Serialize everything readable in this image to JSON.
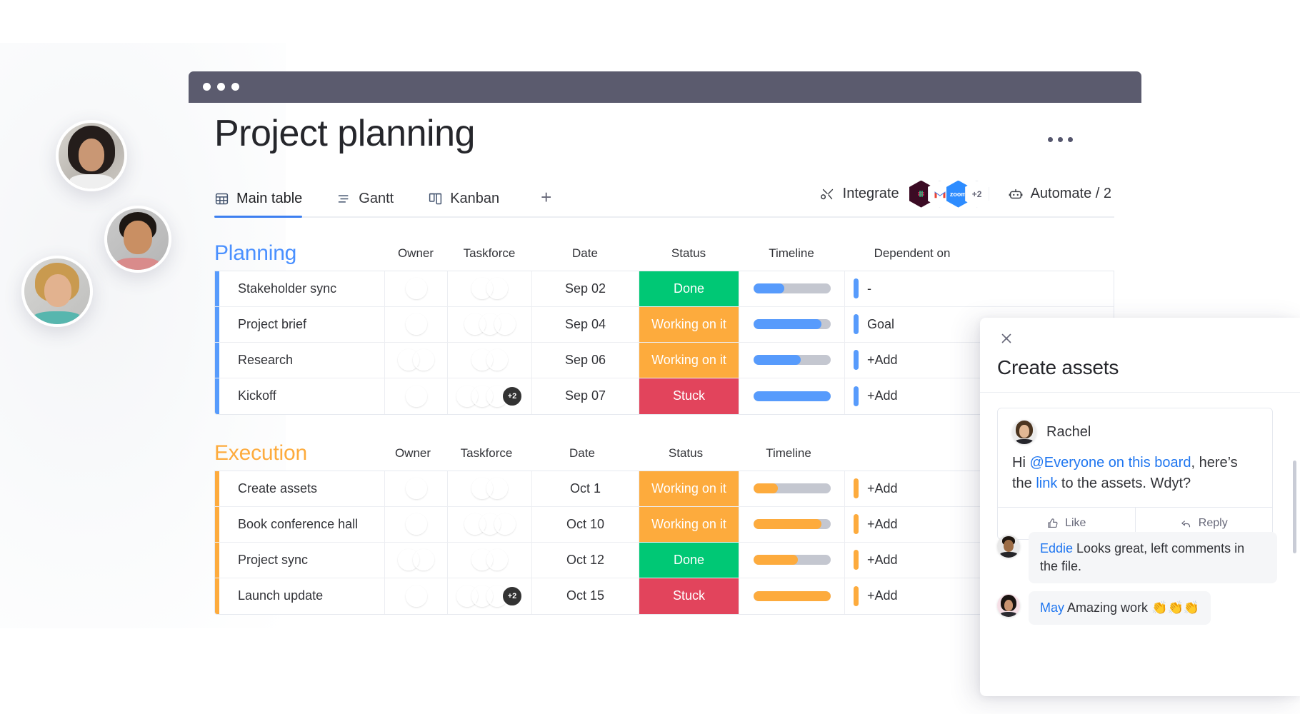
{
  "window": {
    "title_bar_color": "#5b5b6e",
    "dots": [
      "close",
      "minimize",
      "maximize"
    ]
  },
  "board": {
    "title": "Project planning",
    "menu_icon": "kebab-menu-icon"
  },
  "tabs": [
    {
      "label": "Main table",
      "icon": "table-icon",
      "active": true
    },
    {
      "label": "Gantt",
      "icon": "gantt-icon",
      "active": false
    },
    {
      "label": "Kanban",
      "icon": "kanban-icon",
      "active": false
    }
  ],
  "tab_add_label": "+",
  "toolbar": {
    "integrate_label": "Integrate",
    "integrate_icon": "integrate-icon",
    "integrations": [
      {
        "name": "slack",
        "label": ""
      },
      {
        "name": "gmail",
        "label": "M"
      },
      {
        "name": "zoom",
        "label": "zoom"
      },
      {
        "name": "more",
        "label": "+2"
      }
    ],
    "automate_label": "Automate / 2",
    "automate_icon": "robot-icon"
  },
  "columns": [
    "Owner",
    "Taskforce",
    "Date",
    "Status",
    "Timeline",
    "Dependent on"
  ],
  "groups": [
    {
      "name": "Planning",
      "color": "#4a90ff",
      "accent": "planning",
      "bar_color": "#579bfc",
      "rows": [
        {
          "name": "Stakeholder sync",
          "owner_count": 1,
          "taskforce_count": 2,
          "taskforce_extra": "",
          "date": "Sep 02",
          "status": "Done",
          "status_class": "done",
          "progress": 40,
          "dependent": "-"
        },
        {
          "name": "Project brief",
          "owner_count": 1,
          "taskforce_count": 3,
          "taskforce_extra": "",
          "date": "Sep 04",
          "status": "Working on it",
          "status_class": "working",
          "progress": 88,
          "dependent": "Goal"
        },
        {
          "name": "Research",
          "owner_count": 2,
          "taskforce_count": 2,
          "taskforce_extra": "",
          "date": "Sep 06",
          "status": "Working on it",
          "status_class": "working",
          "progress": 62,
          "dependent": "+Add"
        },
        {
          "name": "Kickoff",
          "owner_count": 1,
          "taskforce_count": 3,
          "taskforce_extra": "+2",
          "date": "Sep 07",
          "status": "Stuck",
          "status_class": "stuck",
          "progress": 100,
          "dependent": "+Add"
        }
      ]
    },
    {
      "name": "Execution",
      "color": "#fdab3d",
      "accent": "execution",
      "bar_color": "#fdab3d",
      "rows": [
        {
          "name": "Create assets",
          "owner_count": 1,
          "taskforce_count": 2,
          "taskforce_extra": "",
          "date": "Oct 1",
          "status": "Working on it",
          "status_class": "working",
          "progress": 32,
          "dependent": "+Add"
        },
        {
          "name": "Book conference hall",
          "owner_count": 1,
          "taskforce_count": 3,
          "taskforce_extra": "",
          "date": "Oct 10",
          "status": "Working on it",
          "status_class": "working",
          "progress": 88,
          "dependent": "+Add"
        },
        {
          "name": "Project sync",
          "owner_count": 2,
          "taskforce_count": 2,
          "taskforce_extra": "",
          "date": "Oct 12",
          "status": "Done",
          "status_class": "done",
          "progress": 58,
          "dependent": "+Add"
        },
        {
          "name": "Launch update",
          "owner_count": 1,
          "taskforce_count": 3,
          "taskforce_extra": "+2",
          "date": "Oct 15",
          "status": "Stuck",
          "status_class": "stuck",
          "progress": 100,
          "dependent": "+Add"
        }
      ]
    }
  ],
  "panel": {
    "close_icon": "close-icon",
    "title": "Create assets",
    "comment": {
      "author": "Rachel",
      "text_parts": [
        {
          "type": "text",
          "value": "Hi "
        },
        {
          "type": "mention",
          "value": "@Everyone on this board"
        },
        {
          "type": "text",
          "value": ", here’s the "
        },
        {
          "type": "link",
          "value": "link"
        },
        {
          "type": "text",
          "value": " to the assets. Wdyt?"
        }
      ],
      "like_label": "Like",
      "like_icon": "thumbs-up-icon",
      "reply_label": "Reply",
      "reply_icon": "reply-arrow-icon"
    },
    "replies": [
      {
        "author": "Eddie",
        "text": " Looks great, left comments in the file."
      },
      {
        "author": "May",
        "text": " Amazing work 👏👏👏"
      }
    ]
  },
  "floating_avatars": [
    {
      "name": "avatar-woman-dark-hair"
    },
    {
      "name": "avatar-man-smiling"
    },
    {
      "name": "avatar-woman-blonde"
    }
  ],
  "colors": {
    "accent_blue": "#3d7ff0",
    "group_planning": "#4a90ff",
    "group_execution": "#fdab3d",
    "status_done": "#00c875",
    "status_working": "#fdab3d",
    "status_stuck": "#e2445c",
    "timeline_track": "#c4c7d0"
  }
}
